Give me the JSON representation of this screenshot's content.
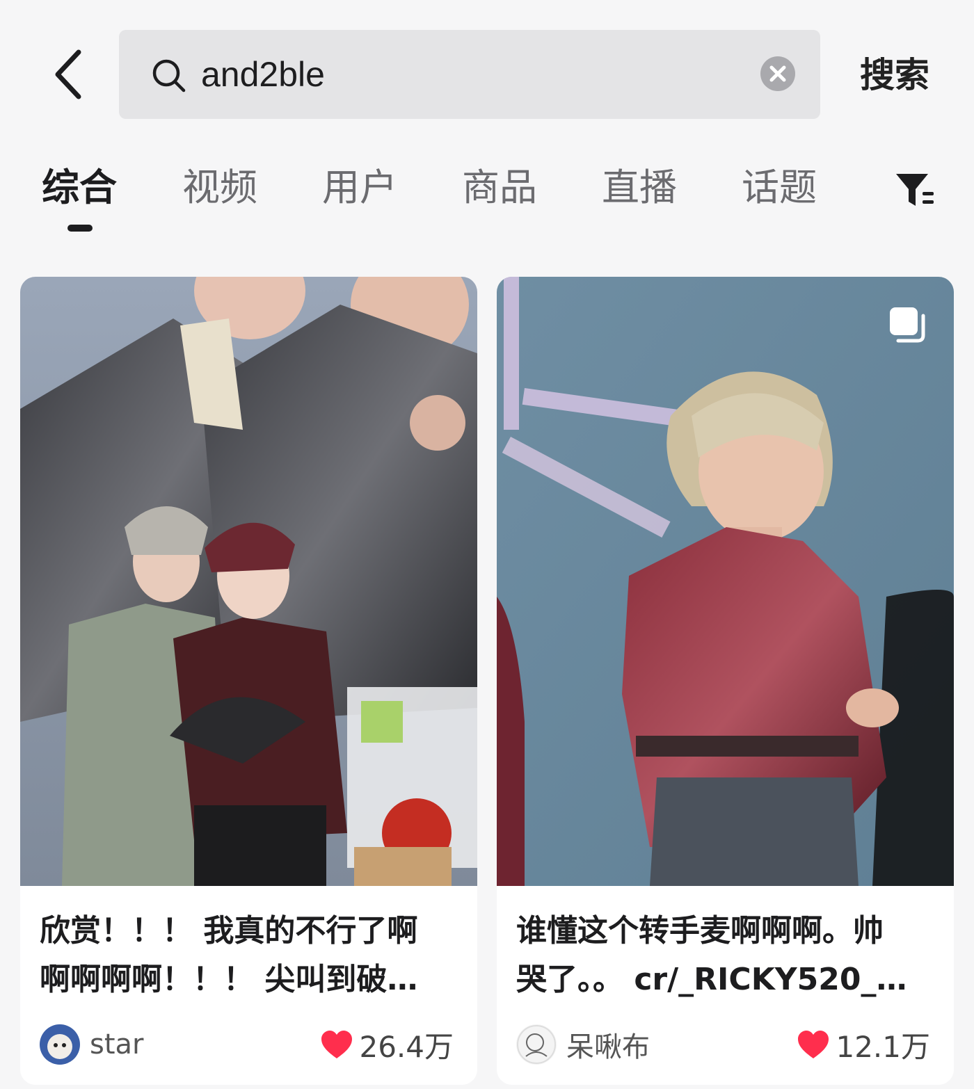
{
  "search": {
    "back_icon": "chevron-left-icon",
    "query": "and2ble",
    "search_icon": "search-icon",
    "clear_icon": "clear-circle-icon",
    "submit_label": "搜索"
  },
  "tabs": [
    {
      "label": "综合",
      "active": true
    },
    {
      "label": "视频",
      "active": false
    },
    {
      "label": "用户",
      "active": false
    },
    {
      "label": "商品",
      "active": false
    },
    {
      "label": "直播",
      "active": false
    },
    {
      "label": "话题",
      "active": false
    }
  ],
  "filter_icon": "filter-icon",
  "cards": [
    {
      "title_line1": "欣赏！！！ 我真的不行了啊",
      "title_line2": "啊啊啊啊！！！ 尖叫到破…",
      "author": "star",
      "likes": "26.4万",
      "multi_image": false
    },
    {
      "title_line1": "谁懂这个转手麦啊啊啊。帅",
      "title_line2": "哭了。。 cr/_RICKY520_…",
      "author": "呆啾布",
      "likes": "12.1万",
      "multi_image": true
    }
  ],
  "colors": {
    "background": "#f6f6f7",
    "search_box": "#e4e4e6",
    "heart": "#ff2e4d",
    "text_primary": "#1d1d1f",
    "text_secondary": "#6b6b6f"
  }
}
